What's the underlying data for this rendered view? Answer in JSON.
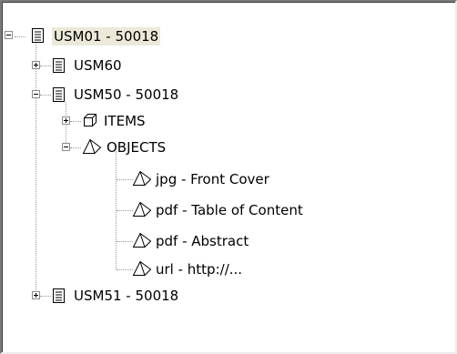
{
  "tree": {
    "nodes": [
      {
        "label": "USM01 - 50018",
        "state": "expanded",
        "icon": "record-icon",
        "selected": true
      },
      {
        "label": "USM60",
        "state": "collapsed",
        "icon": "record-icon"
      },
      {
        "label": "USM50 - 50018",
        "state": "expanded",
        "icon": "record-icon"
      },
      {
        "label": "ITEMS",
        "state": "collapsed",
        "icon": "cube-icon"
      },
      {
        "label": "OBJECTS",
        "state": "expanded",
        "icon": "pyramid-icon"
      },
      {
        "label": "jpg - Front Cover",
        "icon": "pyramid-icon"
      },
      {
        "label": "pdf - Table of Content",
        "icon": "pyramid-icon"
      },
      {
        "label": "pdf - Abstract",
        "icon": "pyramid-icon"
      },
      {
        "label": "url - http://...",
        "icon": "pyramid-icon"
      },
      {
        "label": "USM51 - 50018",
        "state": "collapsed",
        "icon": "record-icon"
      }
    ]
  },
  "colors": {
    "selection": "#ece9d8",
    "connector": "#9a9a9a"
  }
}
